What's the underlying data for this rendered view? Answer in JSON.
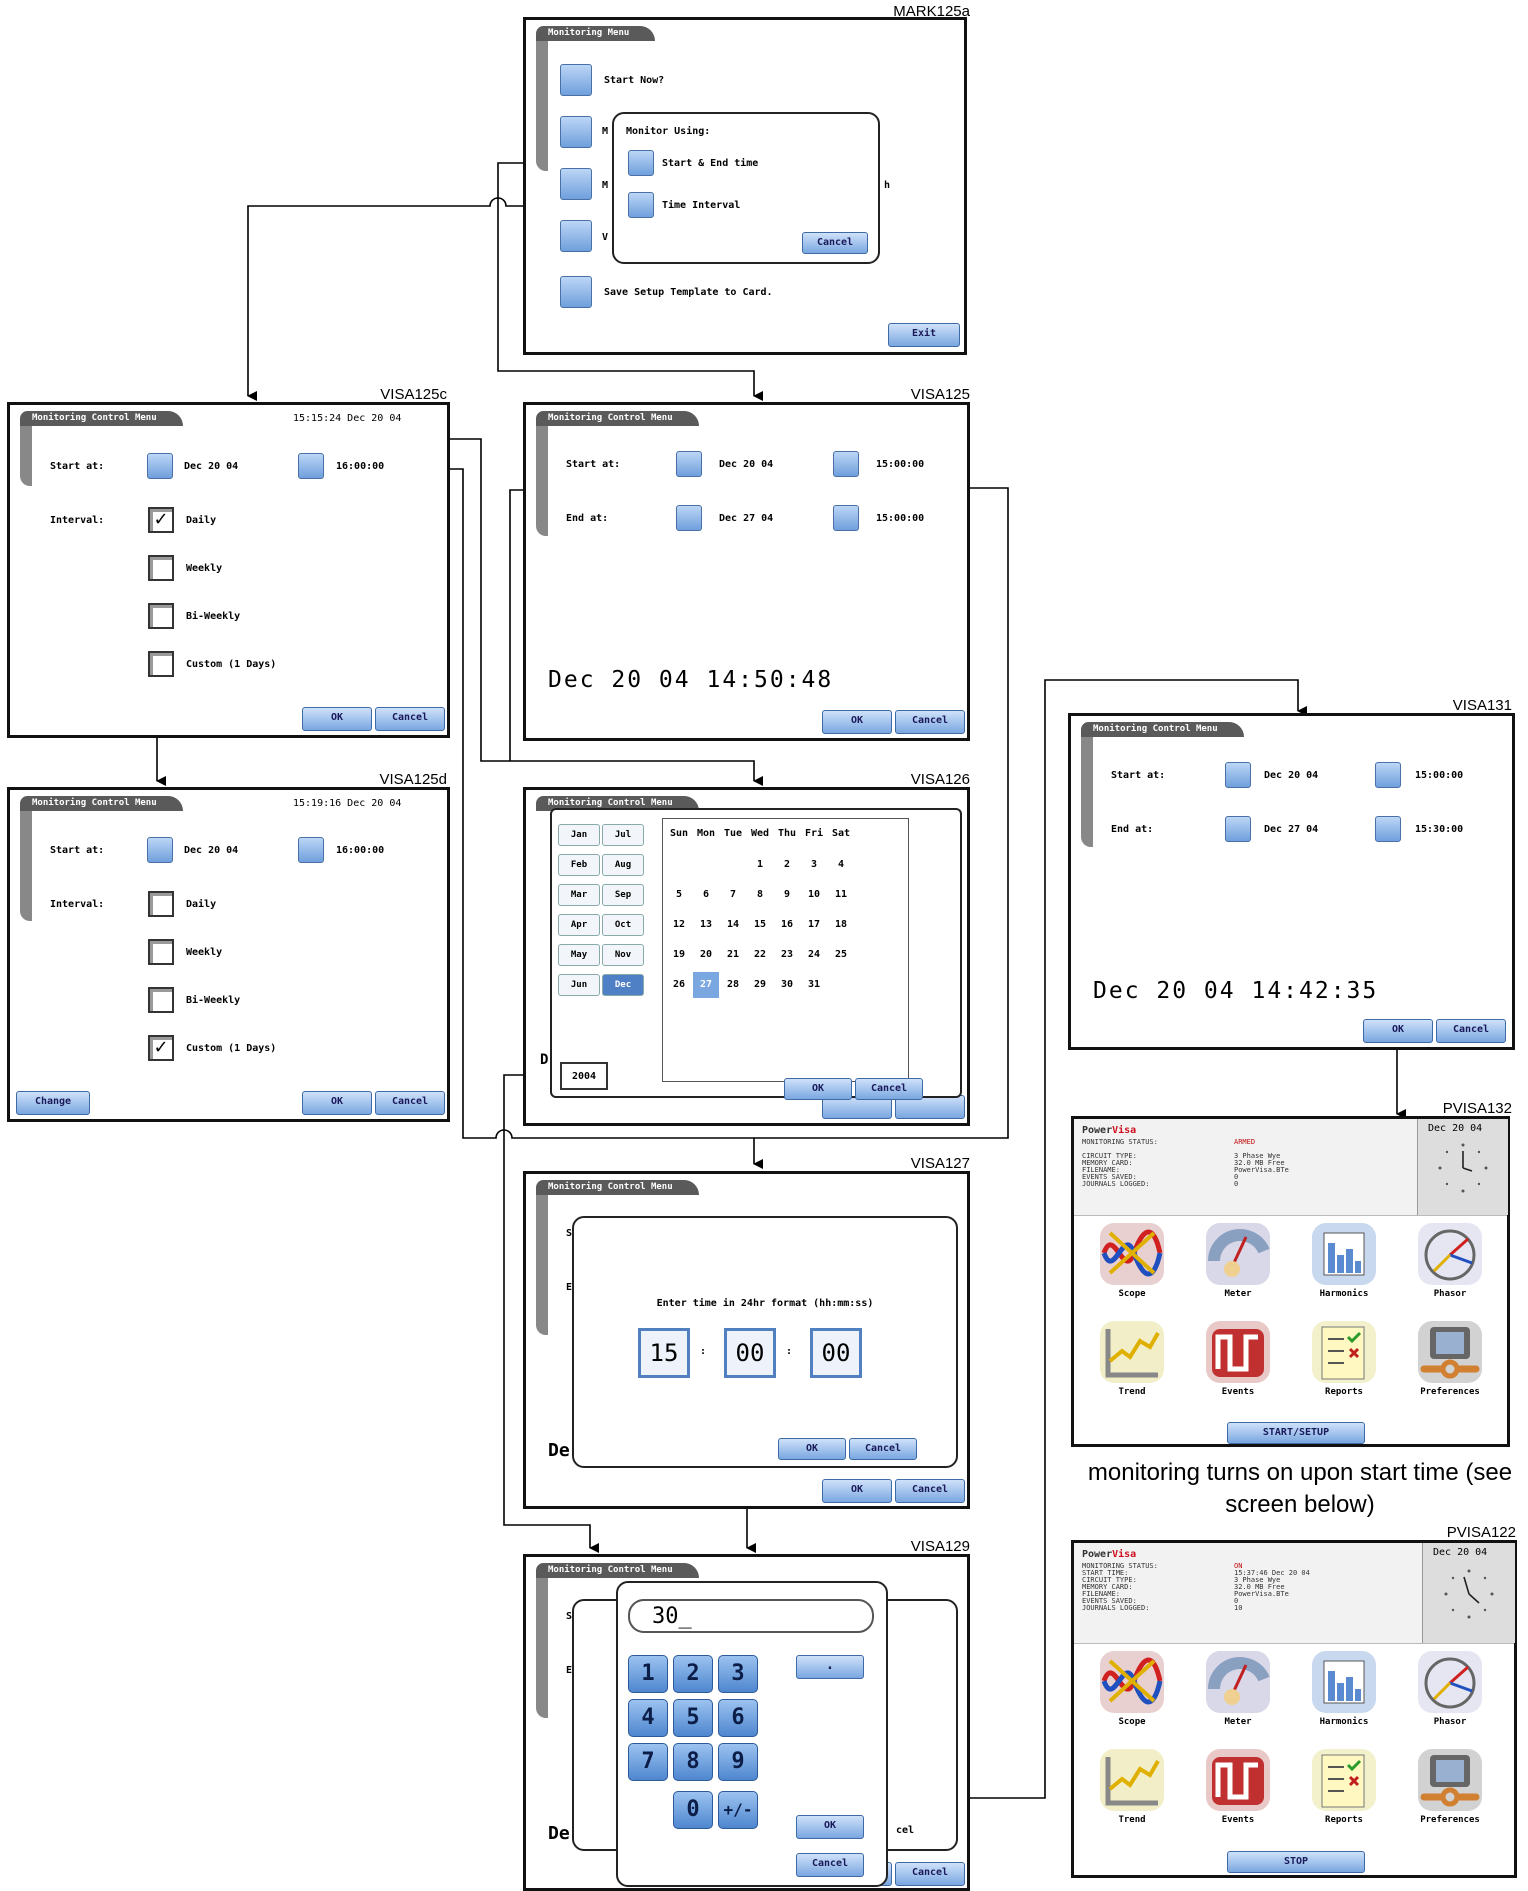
{
  "labels": {
    "mark125a": "MARK125a",
    "visa125c": "VISA125c",
    "visa125": "VISA125",
    "visa125d": "VISA125d",
    "visa126": "VISA126",
    "visa127": "VISA127",
    "visa129": "VISA129",
    "visa131": "VISA131",
    "pvisa132": "PVISA132",
    "pvisa122": "PVISA122"
  },
  "mark125a": {
    "title": "Monitoring Menu",
    "start_now": "Start Now?",
    "save_template": "Save Setup Template to Card.",
    "exit": "Exit",
    "dialog_title": "Monitor Using:",
    "start_end_time": "Start & End time",
    "time_interval": "Time Interval",
    "cancel": "Cancel",
    "cut_h1": "M",
    "cut_h2": "M",
    "cut_v": "V",
    "cut_h": "h"
  },
  "visa125c": {
    "title": "Monitoring Control Menu",
    "clock": "15:15:24 Dec 20 04",
    "start_at": "Start at:",
    "start_date": "Dec 20 04",
    "start_time": "16:00:00",
    "interval": "Interval:",
    "daily": "Daily",
    "weekly": "Weekly",
    "biweekly": "Bi-Weekly",
    "custom": "Custom (1 Days)",
    "ok": "OK",
    "cancel": "Cancel"
  },
  "visa125": {
    "title": "Monitoring Control Menu",
    "start_at": "Start at:",
    "end_at": "End at:",
    "start_date": "Dec 20 04",
    "start_time": "15:00:00",
    "end_date": "Dec 27 04",
    "end_time": "15:00:00",
    "now": "Dec 20 04 14:50:48",
    "ok": "OK",
    "cancel": "Cancel"
  },
  "visa125d": {
    "title": "Monitoring Control Menu",
    "clock": "15:19:16 Dec 20 04",
    "start_at": "Start at:",
    "start_date": "Dec 20 04",
    "start_time": "16:00:00",
    "interval": "Interval:",
    "daily": "Daily",
    "weekly": "Weekly",
    "biweekly": "Bi-Weekly",
    "custom": "Custom (1 Days)",
    "change": "Change",
    "ok": "OK",
    "cancel": "Cancel"
  },
  "visa126": {
    "title": "Monitoring Control Menu",
    "months_left": [
      "Jan",
      "Feb",
      "Mar",
      "Apr",
      "May",
      "Jun"
    ],
    "months_right": [
      "Jul",
      "Aug",
      "Sep",
      "Oct",
      "Nov",
      "Dec"
    ],
    "weekdays": [
      "Sun",
      "Mon",
      "Tue",
      "Wed",
      "Thu",
      "Fri",
      "Sat"
    ],
    "days": [
      "1",
      "2",
      "3",
      "4",
      "5",
      "6",
      "7",
      "8",
      "9",
      "10",
      "11",
      "12",
      "13",
      "14",
      "15",
      "16",
      "17",
      "18",
      "19",
      "20",
      "21",
      "22",
      "23",
      "24",
      "25",
      "26",
      "27",
      "28",
      "29",
      "30",
      "31"
    ],
    "selected_day": "27",
    "selected_month": "Dec",
    "year": "2004",
    "cut_d": "D",
    "ok": "OK",
    "cancel": "Cancel"
  },
  "visa127": {
    "title": "Monitoring Control Menu",
    "prompt": "Enter time in 24hr format (hh:mm:ss)",
    "hh": "15",
    "mm": "00",
    "ss": "00",
    "sep": ":",
    "cut_s": "S",
    "cut_e": "E",
    "cut_de": "De",
    "ok": "OK",
    "cancel": "Cancel"
  },
  "visa129": {
    "title": "Monitoring Control Menu",
    "entry": "30_",
    "keys": [
      "1",
      "2",
      "3",
      "4",
      "5",
      "6",
      "7",
      "8",
      "9",
      "0",
      "+/-"
    ],
    "dot": ".",
    "ok": "OK",
    "cancel": "Cancel",
    "cut_s": "S",
    "cut_e": "E",
    "cut_de": "De",
    "cut_cel": "cel"
  },
  "visa131": {
    "title": "Monitoring Control Menu",
    "start_at": "Start at:",
    "end_at": "End at:",
    "start_date": "Dec 20 04",
    "start_time": "15:00:00",
    "end_date": "Dec 27 04",
    "end_time": "15:30:00",
    "now": "Dec 20 04 14:42:35",
    "ok": "OK",
    "cancel": "Cancel"
  },
  "pvisa132": {
    "brand_a": "Power",
    "brand_b": "Visa",
    "date": "Dec 20 04",
    "keys": "MONITORING STATUS:\n\nCIRCUIT TYPE:\nMEMORY CARD:\nFILENAME:\nEVENTS SAVED:\nJOURNALS LOGGED:",
    "status": "ARMED",
    "vals": "\n\n3 Phase Wye\n32.0 MB Free\nPowerVisa.BTe\n0\n0",
    "tiles": [
      "Scope",
      "Meter",
      "Harmonics",
      "Phasor",
      "Trend",
      "Events",
      "Reports",
      "Preferences"
    ],
    "action": "START/SETUP"
  },
  "pvisa122": {
    "brand_a": "Power",
    "brand_b": "Visa",
    "date": "Dec 20 04",
    "keys": "MONITORING STATUS:\nSTART TIME:\nCIRCUIT TYPE:\nMEMORY CARD:\nFILENAME:\nEVENTS SAVED:\nJOURNALS LOGGED:",
    "status": "ON",
    "vals": "\n15:37:46 Dec 20 04\n3 Phase Wye\n32.0 MB Free\nPowerVisa.BTe\n0\n10",
    "tiles": [
      "Scope",
      "Meter",
      "Harmonics",
      "Phasor",
      "Trend",
      "Events",
      "Reports",
      "Preferences"
    ],
    "action": "STOP"
  },
  "caption": "monitoring turns on upon start time (see screen below)"
}
